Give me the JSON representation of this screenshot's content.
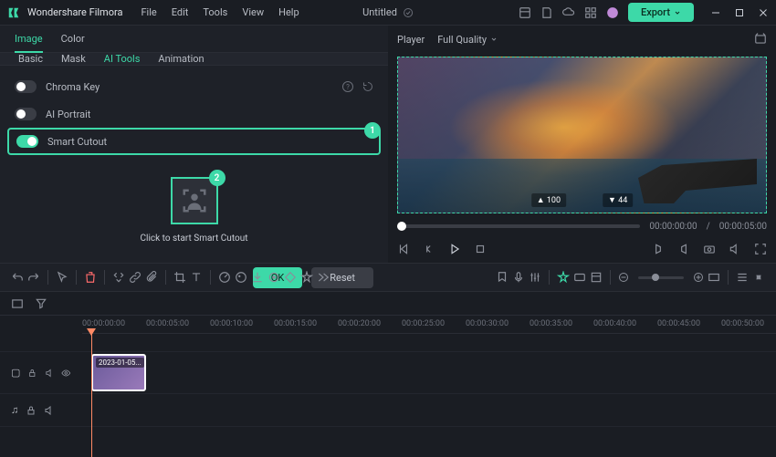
{
  "app": {
    "name": "Wondershare Filmora",
    "title": "Untitled"
  },
  "menu": [
    "File",
    "Edit",
    "Tools",
    "View",
    "Help"
  ],
  "export": "Export",
  "panel": {
    "tabs": [
      "Image",
      "Color"
    ],
    "active_tab": 0,
    "sub_tabs": [
      "Basic",
      "Mask",
      "AI Tools",
      "Animation"
    ],
    "active_sub": 2,
    "tools": [
      {
        "label": "Chroma Key",
        "on": false,
        "info": true
      },
      {
        "label": "AI Portrait",
        "on": false,
        "info": false
      },
      {
        "label": "Smart Cutout",
        "on": true,
        "info": false,
        "highlighted": true,
        "badge": "1"
      }
    ],
    "cutout": {
      "label": "Click to start Smart Cutout",
      "badge": "2"
    },
    "ok": "OK",
    "reset": "Reset"
  },
  "player": {
    "label": "Player",
    "quality": "Full Quality",
    "hud": {
      "left": "▲ 100",
      "right": "▼ 44"
    },
    "time_current": "00:00:00:00",
    "time_total": "00:00:05:00"
  },
  "timeline": {
    "ticks": [
      "00:00:00:00",
      "00:00:05:00",
      "00:00:10:00",
      "00:00:15:00",
      "00:00:20:00",
      "00:00:25:00",
      "00:00:30:00",
      "00:00:35:00",
      "00:00:40:00",
      "00:00:45:00",
      "00:00:50:00"
    ],
    "clip": {
      "label": "2023-01-05..."
    },
    "tracks": {
      "video": "▢",
      "audio": "♫"
    }
  }
}
